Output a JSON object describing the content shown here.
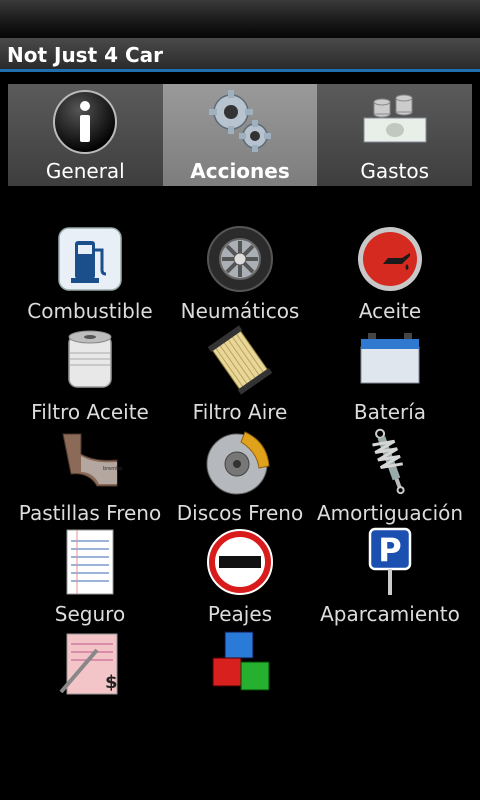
{
  "app": {
    "title": "Not Just 4 Car"
  },
  "tabs": [
    {
      "label": "General",
      "icon": "info-icon",
      "selected": false
    },
    {
      "label": "Acciones",
      "icon": "gears-icon",
      "selected": true
    },
    {
      "label": "Gastos",
      "icon": "money-icon",
      "selected": false
    }
  ],
  "actions": [
    {
      "label": "Combustible",
      "icon": "fuel-pump-icon"
    },
    {
      "label": "Neumáticos",
      "icon": "tire-icon"
    },
    {
      "label": "Aceite",
      "icon": "oil-warning-icon"
    },
    {
      "label": "Filtro Aceite",
      "icon": "oil-filter-icon"
    },
    {
      "label": "Filtro Aire",
      "icon": "air-filter-icon"
    },
    {
      "label": "Batería",
      "icon": "battery-icon"
    },
    {
      "label": "Pastillas Freno",
      "icon": "brake-pads-icon"
    },
    {
      "label": "Discos Freno",
      "icon": "brake-disc-icon"
    },
    {
      "label": "Amortiguación",
      "icon": "shock-absorber-icon"
    },
    {
      "label": "Seguro",
      "icon": "insurance-document-icon"
    },
    {
      "label": "Peajes",
      "icon": "no-entry-sign-icon"
    },
    {
      "label": "Aparcamiento",
      "icon": "parking-sign-icon"
    },
    {
      "label": "",
      "icon": "invoice-pen-icon"
    },
    {
      "label": "",
      "icon": "colored-cubes-icon"
    }
  ],
  "colors": {
    "accent": "#1e6fb0",
    "tab_selected": "#8c8c8c",
    "tab": "#4a4a4a"
  }
}
